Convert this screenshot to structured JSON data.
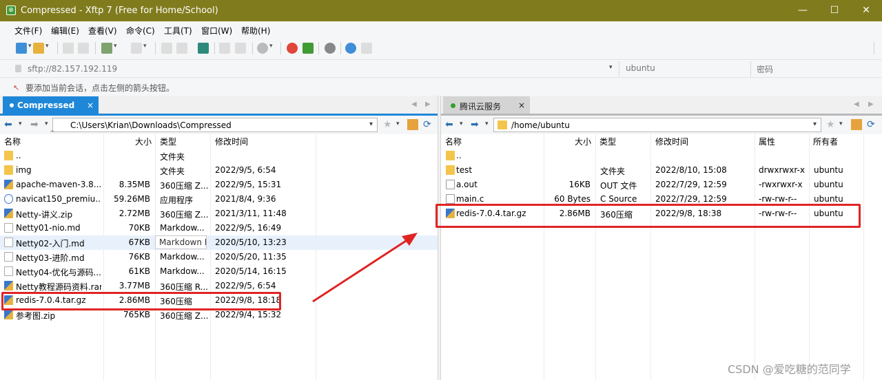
{
  "window": {
    "title": "Compressed - Xftp 7 (Free for Home/School)",
    "icon_glyph": "⊕",
    "min_glyph": "—",
    "max_glyph": "☐",
    "close_glyph": "✕"
  },
  "menu": [
    "文件(F)",
    "编辑(E)",
    "查看(V)",
    "命令(C)",
    "工具(T)",
    "窗口(W)",
    "帮助(H)"
  ],
  "address": {
    "url_placeholder": "sftp://82.157.192.119",
    "user_placeholder": "ubuntu",
    "password_placeholder": "密码",
    "dropdown_glyph": "▾"
  },
  "hint": {
    "text": "要添加当前会话，点击左侧的箭头按钮。",
    "icon_glyph": "↖"
  },
  "left": {
    "tab_label": "Compressed",
    "tab_close": "×",
    "path": "C:\\Users\\Krian\\Downloads\\Compressed",
    "headers": {
      "name": "名称",
      "size": "大小",
      "type": "类型",
      "modified": "修改时间"
    },
    "rows": [
      {
        "icon": "folder",
        "name": "..",
        "size": "",
        "type": "文件夹",
        "modified": ""
      },
      {
        "icon": "folder",
        "name": "img",
        "size": "",
        "type": "文件夹",
        "modified": "2022/9/5, 6:54"
      },
      {
        "icon": "zip",
        "name": "apache-maven-3.8....",
        "size": "8.35MB",
        "type": "360压缩 Z...",
        "modified": "2022/9/5, 15:31"
      },
      {
        "icon": "exe",
        "name": "navicat150_premiu...",
        "size": "59.26MB",
        "type": "应用程序",
        "modified": "2021/8/4, 9:36"
      },
      {
        "icon": "zip",
        "name": "Netty-讲义.zip",
        "size": "2.72MB",
        "type": "360压缩 Z...",
        "modified": "2021/3/11, 11:48"
      },
      {
        "icon": "md",
        "name": "Netty01-nio.md",
        "size": "70KB",
        "type": "Markdow...",
        "modified": "2022/9/5, 16:49"
      },
      {
        "icon": "md",
        "name": "Netty02-入门.md",
        "size": "67KB",
        "type": "Markdow...",
        "modified": "2020/5/10, 13:23"
      },
      {
        "icon": "md",
        "name": "Netty03-进阶.md",
        "size": "76KB",
        "type": "Markdow...",
        "modified": "2020/5/20, 11:35"
      },
      {
        "icon": "md",
        "name": "Netty04-优化与源码...",
        "size": "61KB",
        "type": "Markdow...",
        "modified": "2020/5/14, 16:15"
      },
      {
        "icon": "zip",
        "name": "Netty教程源码资料.rar",
        "size": "3.77MB",
        "type": "360压缩 R...",
        "modified": "2022/9/5, 6:54"
      },
      {
        "icon": "zip",
        "name": "redis-7.0.4.tar.gz",
        "size": "2.86MB",
        "type": "360压缩",
        "modified": "2022/9/8, 18:18"
      },
      {
        "icon": "zip",
        "name": "参考图.zip",
        "size": "765KB",
        "type": "360压缩 Z...",
        "modified": "2022/9/4, 15:32"
      }
    ],
    "tooltip": "Markdown File"
  },
  "right": {
    "tab_label": "腾讯云服务",
    "tab_close": "×",
    "path": "/home/ubuntu",
    "headers": {
      "name": "名称",
      "size": "大小",
      "type": "类型",
      "modified": "修改时间",
      "attrs": "属性",
      "owner": "所有者"
    },
    "rows": [
      {
        "icon": "folder",
        "name": "..",
        "size": "",
        "type": "",
        "modified": "",
        "attrs": "",
        "owner": ""
      },
      {
        "icon": "folder",
        "name": "test",
        "size": "",
        "type": "文件夹",
        "modified": "2022/8/10, 15:08",
        "attrs": "drwxrwxr-x",
        "owner": "ubuntu"
      },
      {
        "icon": "doc",
        "name": "a.out",
        "size": "16KB",
        "type": "OUT 文件",
        "modified": "2022/7/29, 12:59",
        "attrs": "-rwxrwxr-x",
        "owner": "ubuntu"
      },
      {
        "icon": "doc",
        "name": "main.c",
        "size": "60 Bytes",
        "type": "C Source",
        "modified": "2022/7/29, 12:59",
        "attrs": "-rw-rw-r--",
        "owner": "ubuntu"
      },
      {
        "icon": "zip",
        "name": "redis-7.0.4.tar.gz",
        "size": "2.86MB",
        "type": "360压缩",
        "modified": "2022/9/8, 18:38",
        "attrs": "-rw-rw-r--",
        "owner": "ubuntu"
      }
    ]
  },
  "nav": {
    "back": "⬅",
    "forward": "➡",
    "dropdown": "▾",
    "star": "★",
    "refresh": "⟳",
    "tab_prev": "◀",
    "tab_next": "▶"
  },
  "watermark": "CSDN @爱吃糖的范同学",
  "colors": {
    "titlebar": "#807c1d",
    "tab_active": "#1e87d8",
    "highlight": "#e02424"
  }
}
